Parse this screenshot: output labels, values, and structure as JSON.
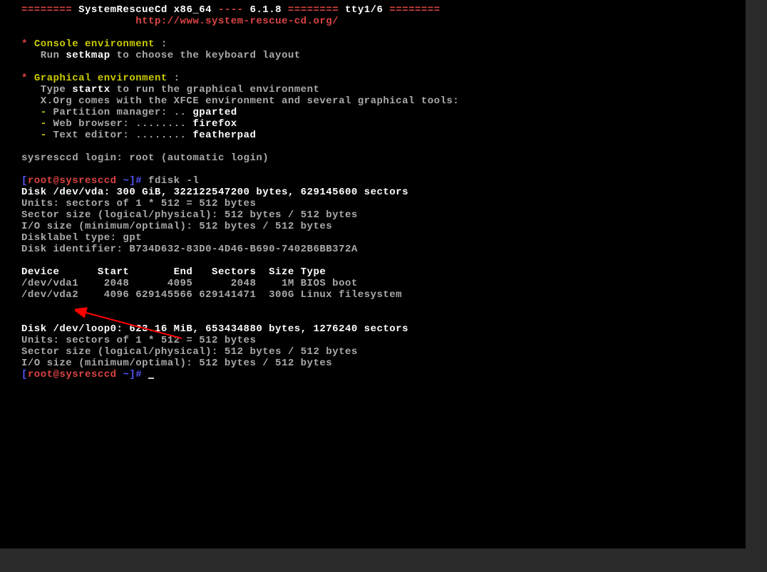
{
  "header": {
    "eq1": "========",
    "title1": "SystemRescueCd x86_64",
    "dashes": "----",
    "version": "6.1.8",
    "eq2": "========",
    "tty": "tty1/6",
    "eq3": "========",
    "url": "http://www.system-rescue-cd.org/"
  },
  "console_env": {
    "star": "*",
    "title": "Console environment",
    "colon": " :",
    "run": "   Run ",
    "setkmap": "setkmap",
    "rest": " to choose the keyboard layout"
  },
  "graphical_env": {
    "star": "*",
    "title": "Graphical environment",
    "colon": " :",
    "type": "   Type ",
    "startx": "startx",
    "rest1": " to run the graphical environment",
    "xorg": "   X.Org comes with the XFCE environment and several graphical tools:",
    "dash": "   -",
    "pm_label": " Partition manager: .. ",
    "pm_tool": "gparted",
    "wb_label": " Web browser: ........ ",
    "wb_tool": "firefox",
    "te_label": " Text editor: ........ ",
    "te_tool": "featherpad"
  },
  "login": "sysresccd login: root (automatic login)",
  "prompt1": {
    "bracket_open": "[",
    "user_host": "root@sysresccd ",
    "tilde": "~",
    "bracket_close": "]#",
    "cmd": " fdisk -l"
  },
  "disk_vda": {
    "header": "Disk /dev/vda: 300 GiB, 322122547200 bytes, 629145600 sectors",
    "units": "Units: sectors of 1 * 512 = 512 bytes",
    "sector": "Sector size (logical/physical): 512 bytes / 512 bytes",
    "io": "I/O size (minimum/optimal): 512 bytes / 512 bytes",
    "label": "Disklabel type: gpt",
    "ident": "Disk identifier: B734D632-83D0-4D46-B690-7402B6BB372A"
  },
  "partitions": {
    "header": "Device      Start       End   Sectors  Size Type",
    "row1": "/dev/vda1    2048      4095      2048    1M BIOS boot",
    "row2": "/dev/vda2    4096 629145566 629141471  300G Linux filesystem"
  },
  "disk_loop": {
    "header": "Disk /dev/loop0: 623.16 MiB, 653434880 bytes, 1276240 sectors",
    "units": "Units: sectors of 1 * 512 = 512 bytes",
    "sector": "Sector size (logical/physical): 512 bytes / 512 bytes",
    "io": "I/O size (minimum/optimal): 512 bytes / 512 bytes"
  },
  "prompt2": {
    "bracket_open": "[",
    "user_host": "root@sysresccd ",
    "tilde": "~",
    "bracket_close": "]#"
  }
}
